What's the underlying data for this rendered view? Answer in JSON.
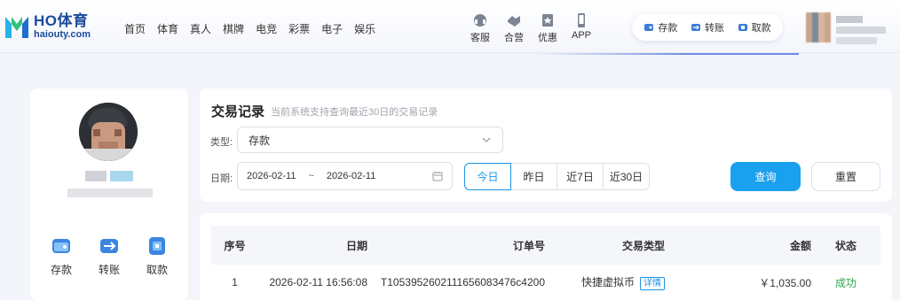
{
  "header": {
    "brand_name": "HO体育",
    "brand_domain": "haiouty.com",
    "nav": [
      "首页",
      "体育",
      "真人",
      "棋牌",
      "电竞",
      "彩票",
      "电子",
      "娱乐"
    ],
    "tools": [
      {
        "label": "客服",
        "icon": "customer-service-icon"
      },
      {
        "label": "合营",
        "icon": "partnership-icon"
      },
      {
        "label": "优惠",
        "icon": "promotion-icon"
      },
      {
        "label": "APP",
        "icon": "mobile-app-icon"
      }
    ],
    "wallet": [
      {
        "label": "存款",
        "icon": "deposit-icon"
      },
      {
        "label": "转账",
        "icon": "transfer-icon"
      },
      {
        "label": "取款",
        "icon": "withdraw-icon"
      }
    ]
  },
  "sidebar": {
    "actions": [
      {
        "label": "存款",
        "icon": "deposit-icon"
      },
      {
        "label": "转账",
        "icon": "transfer-icon"
      },
      {
        "label": "取款",
        "icon": "withdraw-icon"
      }
    ]
  },
  "filter": {
    "title": "交易记录",
    "note": "当前系统支持查询最近30日的交易记录",
    "type_label": "类型:",
    "type_value": "存款",
    "date_label": "日期:",
    "date_start": "2026-02-11",
    "date_sep": "~",
    "date_end": "2026-02-11",
    "quick": [
      "今日",
      "昨日",
      "近7日",
      "近30日"
    ],
    "active_quick": "今日",
    "query_label": "查询",
    "reset_label": "重置"
  },
  "table": {
    "headers": [
      "序号",
      "日期",
      "订单号",
      "交易类型",
      "金额",
      "状态"
    ],
    "rows": [
      {
        "index": "1",
        "date": "2026-02-11 16:56:08",
        "order": "T1053952602111656083476c4200",
        "type": "快捷虚拟币",
        "detail": "详情",
        "amount": "￥1,035.00",
        "status": "成功"
      }
    ]
  },
  "colors": {
    "accent": "#1aa0ee",
    "success": "#2aa84a",
    "brand": "#1a4b9c"
  }
}
